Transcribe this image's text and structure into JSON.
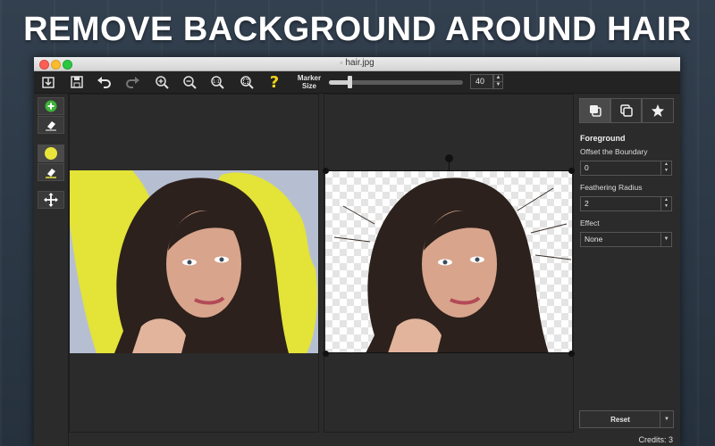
{
  "headline": "REMOVE BACKGROUND AROUND HAIR",
  "window": {
    "title": "hair.jpg"
  },
  "toolbar": {
    "buttons": [
      "export-icon",
      "save-icon",
      "undo-icon",
      "redo-icon",
      "zoom-in-icon",
      "zoom-out-icon",
      "actual-size-icon",
      "fit-screen-icon",
      "help-icon"
    ],
    "help_glyph": "?",
    "marker_label_line1": "Marker",
    "marker_label_line2": "Size",
    "marker_size": "40",
    "marker_slider_fraction": 0.15,
    "stepper_up": "▲",
    "stepper_down": "▼"
  },
  "tools": [
    "add-foreground-icon",
    "eraser-icon",
    "marker-color-icon",
    "eraser-icon",
    "move-icon"
  ],
  "sidebar": {
    "tabs": [
      "layers-icon",
      "duplicate-icon",
      "effects-star-icon"
    ],
    "section_title": "Foreground",
    "offset_label": "Offset the Boundary",
    "offset_value": "0",
    "feather_label": "Feathering Radius",
    "feather_value": "2",
    "effect_label": "Effect",
    "effect_value": "None",
    "reset_label": "Reset"
  },
  "status": {
    "credits": "Credits: 3"
  },
  "colors": {
    "marker": "#e8e63a",
    "add": "#3fb23a",
    "help": "#f2d21b"
  }
}
